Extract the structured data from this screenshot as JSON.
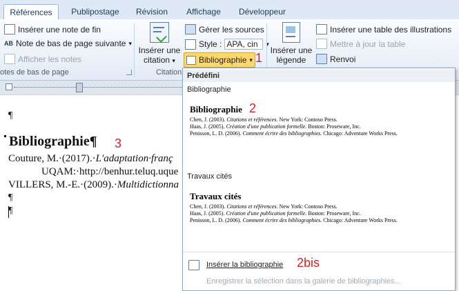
{
  "tabs": [
    "Références",
    "Publipostage",
    "Révision",
    "Affichage",
    "Développeur"
  ],
  "ribbon": {
    "footnotes": {
      "insert_endnote": "Insérer une note de fin",
      "next_footnote": "Note de bas de page suivante",
      "next_footnote_arrow": "▾",
      "show_notes": "Afficher les notes",
      "group_label": "otes de bas de page",
      "ab_glyph": "AB"
    },
    "citations": {
      "insert_citation_line1": "Insérer une",
      "insert_citation_line2": "citation",
      "insert_citation_arrow": "▾",
      "manage_sources": "Gérer les sources",
      "style_label": "Style :",
      "style_value": "APA, cin",
      "style_arrow": "▾",
      "bibliography_button": "Bibliographie",
      "bibliography_arrow": "▾",
      "group_label": "Citation"
    },
    "captions": {
      "insert_caption_line1": "Insérer une",
      "insert_caption_line2": "légende",
      "insert_table_of_figures": "Insérer une table des illustrations",
      "update_table": "Mettre à jour la table",
      "cross_reference": "Renvoi"
    }
  },
  "document": {
    "pilcrow_top": "¶",
    "heading": "Bibliographie¶",
    "entry1_plain": "Couture, M.·(2017).·",
    "entry1_italic": "L'adaptation·franç",
    "entry1_line2": "UQAM:·http://benhur.teluq.uque",
    "entry2_plain": "VILLERS, M.-E.·(2009).·",
    "entry2_italic": "Multidictionna",
    "pilcrow_1": "¶",
    "pilcrow_2": "¶"
  },
  "annotations": {
    "n1": "1",
    "n2": "2",
    "n3": "3",
    "n2bis": "2bis"
  },
  "dropdown": {
    "section_predefined": "Prédéfini",
    "gallery1": {
      "title": "Bibliographie",
      "preview_heading": "Bibliographie",
      "entries": [
        {
          "plain": "Chen, J. (2003). ",
          "italic": "Citations et références.",
          "rest": " New York: Contoso Press."
        },
        {
          "plain": "Haas, J. (2005). ",
          "italic": "Création d'une publication formelle.",
          "rest": " Boston: Proseware, Inc."
        },
        {
          "plain": "Penisson, L. D. (2006). ",
          "italic": "Comment écrire des bibliographies.",
          "rest": " Chicago: Adventure Works Press."
        }
      ]
    },
    "gallery2": {
      "title": "Travaux cités",
      "preview_heading": "Travaux cités",
      "entries": [
        {
          "plain": "Chen, J. (2003). ",
          "italic": "Citations et références.",
          "rest": " New York: Contoso Press."
        },
        {
          "plain": "Haas, J. (2005). ",
          "italic": "Création d'une publication formelle.",
          "rest": " Boston: Proseware, Inc."
        },
        {
          "plain": "Penisson, L. D. (2006). ",
          "italic": "Comment écrire des bibliographies.",
          "rest": " Chicago: Adventure Works Press."
        }
      ]
    },
    "insert_bibliography": "Insérer la bibliographie",
    "save_selection": "Enregistrer la sélection dans la galerie de bibliographies..."
  },
  "colors": {
    "annotation_red": "#e02020",
    "highlight_orange": "#ffd86a"
  }
}
